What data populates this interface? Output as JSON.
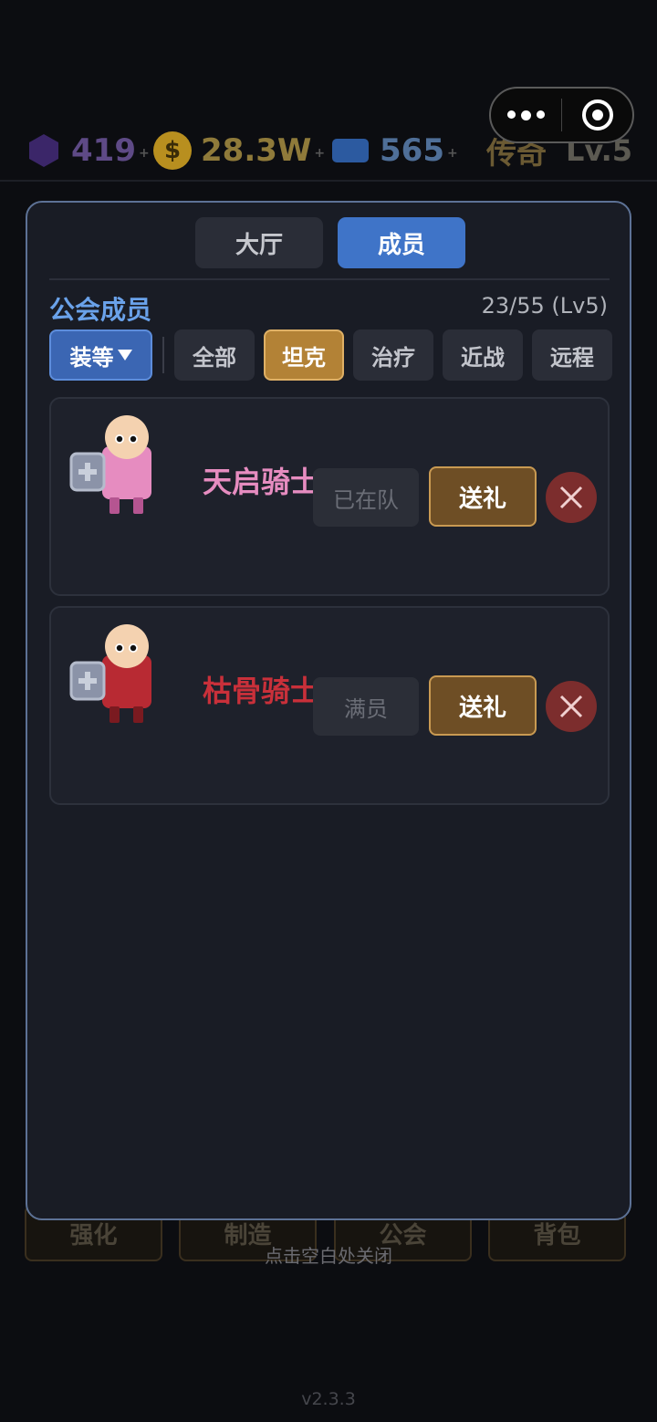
{
  "top_bar": {
    "gems": "419",
    "gold": "28.3W",
    "coin_symbol": "$",
    "tickets": "565",
    "plus_label": "+",
    "rank": "传奇",
    "level": "Lv.5"
  },
  "background": {
    "nav": [
      {
        "label": "强化",
        "icon": "hammer-icon"
      },
      {
        "label": "制造",
        "icon": "anvil-icon"
      },
      {
        "label": "公会",
        "icon": "guild-hall-icon"
      },
      {
        "label": "背包",
        "icon": "bag-icon"
      }
    ],
    "close_hint": "点击空白处关闭",
    "version": "v2.3.3"
  },
  "modal": {
    "tabs": [
      {
        "label": "大厅",
        "active": false
      },
      {
        "label": "成员",
        "active": true
      }
    ],
    "title": "公会成员",
    "count": "23/55 (Lv5)",
    "sort_label": "装等",
    "filters": [
      {
        "label": "全部",
        "active": false
      },
      {
        "label": "坦克",
        "active": true
      },
      {
        "label": "治疗",
        "active": false
      },
      {
        "label": "近战",
        "active": false
      },
      {
        "label": "远程",
        "active": false
      }
    ],
    "members": [
      {
        "name": "天启骑士",
        "name_color": "#e68cc0",
        "body_color": "#e68cc0",
        "status_label": "已在队",
        "gift_label": "送礼"
      },
      {
        "name": "枯骨骑士",
        "name_color": "#c9303a",
        "body_color": "#b82a33",
        "status_label": "满员",
        "gift_label": "送礼"
      }
    ]
  },
  "colors": {
    "accent_blue": "#3f74c8",
    "accent_gold": "#b38236",
    "modal_border": "#5d7296",
    "danger": "#7c2d2d"
  }
}
